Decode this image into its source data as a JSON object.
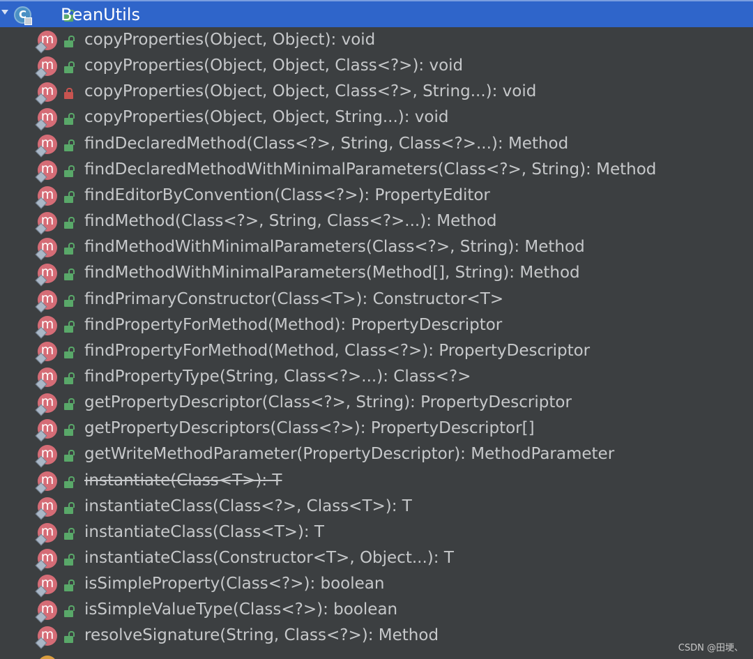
{
  "structure_tree": {
    "root": {
      "class_icon_letter": "C",
      "label": "BeanUtils"
    },
    "method_icon_letter": "m",
    "methods": [
      {
        "label": "copyProperties(Object, Object): void",
        "visibility": "public",
        "deprecated": false
      },
      {
        "label": "copyProperties(Object, Object, Class<?>): void",
        "visibility": "public",
        "deprecated": false
      },
      {
        "label": "copyProperties(Object, Object, Class<?>, String...): void",
        "visibility": "private",
        "deprecated": false
      },
      {
        "label": "copyProperties(Object, Object, String...): void",
        "visibility": "public",
        "deprecated": false
      },
      {
        "label": "findDeclaredMethod(Class<?>, String, Class<?>...): Method",
        "visibility": "public",
        "deprecated": false
      },
      {
        "label": "findDeclaredMethodWithMinimalParameters(Class<?>, String): Method",
        "visibility": "public",
        "deprecated": false
      },
      {
        "label": "findEditorByConvention(Class<?>): PropertyEditor",
        "visibility": "public",
        "deprecated": false
      },
      {
        "label": "findMethod(Class<?>, String, Class<?>...): Method",
        "visibility": "public",
        "deprecated": false
      },
      {
        "label": "findMethodWithMinimalParameters(Class<?>, String): Method",
        "visibility": "public",
        "deprecated": false
      },
      {
        "label": "findMethodWithMinimalParameters(Method[], String): Method",
        "visibility": "public",
        "deprecated": false
      },
      {
        "label": "findPrimaryConstructor(Class<T>): Constructor<T>",
        "visibility": "public",
        "deprecated": false
      },
      {
        "label": "findPropertyForMethod(Method): PropertyDescriptor",
        "visibility": "public",
        "deprecated": false
      },
      {
        "label": "findPropertyForMethod(Method, Class<?>): PropertyDescriptor",
        "visibility": "public",
        "deprecated": false
      },
      {
        "label": "findPropertyType(String, Class<?>...): Class<?>",
        "visibility": "public",
        "deprecated": false
      },
      {
        "label": "getPropertyDescriptor(Class<?>, String): PropertyDescriptor",
        "visibility": "public",
        "deprecated": false
      },
      {
        "label": "getPropertyDescriptors(Class<?>): PropertyDescriptor[]",
        "visibility": "public",
        "deprecated": false
      },
      {
        "label": "getWriteMethodParameter(PropertyDescriptor): MethodParameter",
        "visibility": "public",
        "deprecated": false
      },
      {
        "label": "instantiate(Class<T>): T",
        "visibility": "public",
        "deprecated": true
      },
      {
        "label": "instantiateClass(Class<?>, Class<T>): T",
        "visibility": "public",
        "deprecated": false
      },
      {
        "label": "instantiateClass(Class<T>): T",
        "visibility": "public",
        "deprecated": false
      },
      {
        "label": "instantiateClass(Constructor<T>, Object...): T",
        "visibility": "public",
        "deprecated": false
      },
      {
        "label": "isSimpleProperty(Class<?>): boolean",
        "visibility": "public",
        "deprecated": false
      },
      {
        "label": "isSimpleValueType(Class<?>): boolean",
        "visibility": "public",
        "deprecated": false
      },
      {
        "label": "resolveSignature(String, Class<?>): Method",
        "visibility": "public",
        "deprecated": false
      }
    ]
  },
  "watermark": "CSDN @田埂、",
  "colors": {
    "background": "#3c3f41",
    "selection": "#2f65ca",
    "method_icon": "#d56c76",
    "public_lock": "#59a869",
    "private_lock": "#c75450",
    "text": "#c6c8ca"
  }
}
